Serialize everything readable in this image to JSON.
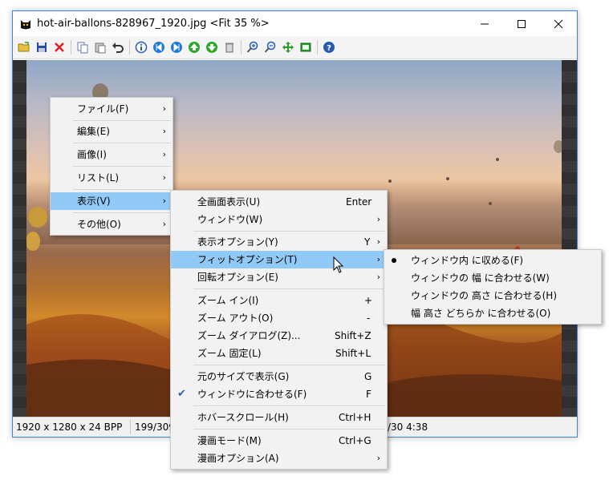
{
  "window": {
    "title": "hot-air-ballons-828967_1920.jpg <Fit 35 %>",
    "icons": [
      "minimize-icon",
      "maximize-icon",
      "close-icon"
    ]
  },
  "toolbar": {
    "icons": [
      "open-folder-icon",
      "save-icon",
      "delete-icon",
      "copy-icon",
      "paste-icon",
      "undo-icon",
      "info-icon",
      "first-icon",
      "last-icon",
      "prev-icon",
      "next-icon",
      "trash-icon",
      "zoom-in-icon",
      "zoom-out-icon",
      "fit-icon",
      "fullscreen-icon",
      "help-icon"
    ]
  },
  "colors": {
    "highlight": "#91c9f7",
    "menu_bg": "#f2f2f2",
    "window_border": "#3c84d6"
  },
  "status": {
    "dimensions": "1920 x 1280 x 24 BPP",
    "position": "199/309",
    "date": "/30 4:38"
  },
  "menu1": {
    "items": [
      {
        "label": "ファイル(F)"
      },
      {
        "label": "編集(E)"
      },
      {
        "label": "画像(I)"
      },
      {
        "label": "リスト(L)"
      },
      {
        "label": "表示(V)"
      },
      {
        "label": "その他(O)"
      }
    ]
  },
  "menu2": {
    "items": [
      {
        "label": "全画面表示(U)",
        "shortcut": "Enter"
      },
      {
        "label": "ウィンドウ(W)"
      },
      {
        "label": "表示オプション(Y)",
        "shortcut": "Y"
      },
      {
        "label": "フィットオプション(T)"
      },
      {
        "label": "回転オプション(E)"
      },
      {
        "label": "ズーム イン(I)",
        "shortcut": "+"
      },
      {
        "label": "ズーム アウト(O)",
        "shortcut": "-"
      },
      {
        "label": "ズーム ダイアログ(Z)...",
        "shortcut": "Shift+Z"
      },
      {
        "label": "ズーム 固定(L)",
        "shortcut": "Shift+L"
      },
      {
        "label": "元のサイズで表示(G)",
        "shortcut": "G"
      },
      {
        "label": "ウィンドウに合わせる(F)",
        "shortcut": "F"
      },
      {
        "label": "ホバースクロール(H)",
        "shortcut": "Ctrl+H"
      },
      {
        "label": "漫画モード(M)",
        "shortcut": "Ctrl+G"
      },
      {
        "label": "漫画オプション(A)"
      }
    ]
  },
  "menu3": {
    "items": [
      {
        "label": "ウィンドウ内 に収める(F)"
      },
      {
        "label": "ウィンドウの 幅 に合わせる(W)"
      },
      {
        "label": "ウィンドウの 高さ に合わせる(H)"
      },
      {
        "label": "幅 高さ どちらか に合わせる(O)"
      }
    ]
  }
}
